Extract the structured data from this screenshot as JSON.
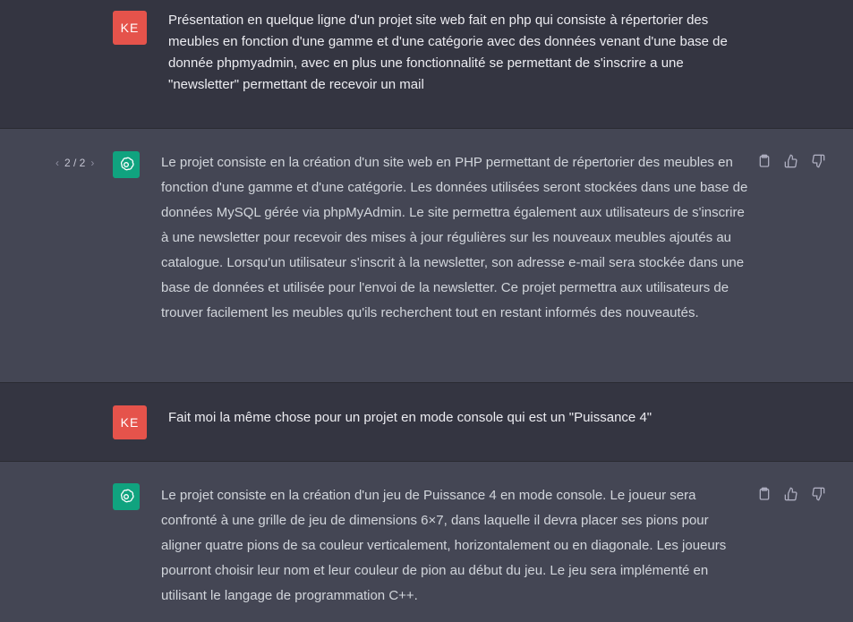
{
  "messages": [
    {
      "role": "user",
      "avatar": "KE",
      "text": "Présentation en quelque ligne d'un projet site web fait en php qui consiste à répertorier des meubles en fonction d'une gamme et d'une catégorie avec des données venant d'une base de donnée phpmyadmin, avec en plus une fonctionnalité se permettant de s'inscrire a une \"newsletter\" permettant de recevoir un mail"
    },
    {
      "role": "assistant",
      "pager": "2 / 2",
      "text": "Le projet consiste en la création d'un site web en PHP permettant de répertorier des meubles en fonction d'une gamme et d'une catégorie. Les données utilisées seront stockées dans une base de données MySQL gérée via phpMyAdmin. Le site permettra également aux utilisateurs de s'inscrire à une newsletter pour recevoir des mises à jour régulières sur les nouveaux meubles ajoutés au catalogue. Lorsqu'un utilisateur s'inscrit à la newsletter, son adresse e-mail sera stockée dans une base de données et utilisée pour l'envoi de la newsletter. Ce projet permettra aux utilisateurs de trouver facilement les meubles qu'ils recherchent tout en restant informés des nouveautés."
    },
    {
      "role": "user",
      "avatar": "KE",
      "text": "Fait moi la même chose pour un projet en mode console qui est un \"Puissance 4\""
    },
    {
      "role": "assistant",
      "text": "Le projet consiste en la création d'un jeu de Puissance 4 en mode console. Le joueur sera confronté à une grille de jeu de dimensions 6×7, dans laquelle il devra placer ses pions pour aligner quatre pions de sa couleur verticalement, horizontalement ou en diagonale. Les joueurs pourront choisir leur nom et leur couleur de pion au début du jeu. Le jeu sera implémenté en utilisant le langage de programmation C++."
    }
  ],
  "icons": {
    "copy": "clipboard-icon",
    "like": "thumbs-up-icon",
    "dislike": "thumbs-down-icon",
    "prev": "chevron-left-icon",
    "next": "chevron-right-icon",
    "assistant": "openai-logo-icon"
  }
}
